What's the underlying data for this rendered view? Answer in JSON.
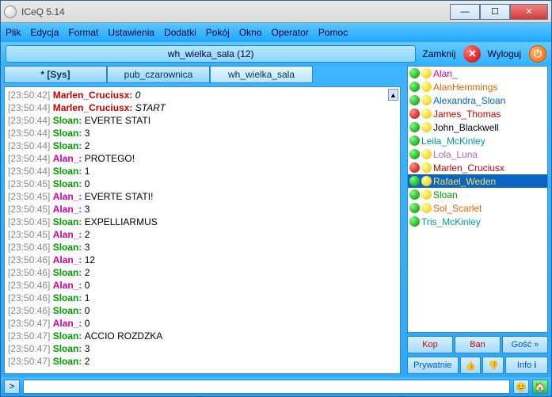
{
  "window": {
    "title": "ICeQ 5.14"
  },
  "menu": [
    "Plik",
    "Edycja",
    "Format",
    "Ustawienia",
    "Dodatki",
    "Pokój",
    "Okno",
    "Operator",
    "Pomoc"
  ],
  "room_header": {
    "title": "wh_wielka_sala (12)",
    "close_label": "Zamknij",
    "logout_label": "Wyloguj"
  },
  "tabs": [
    {
      "label": "* [Sys]",
      "active": false
    },
    {
      "label": "pub_czarownica",
      "active": false
    },
    {
      "label": "wh_wielka_sala",
      "active": true
    }
  ],
  "chat": [
    {
      "ts": "[23:50:42]",
      "nick": "Marlen_Cruciusx",
      "color": "#cc0000",
      "msg": "0",
      "italic": true
    },
    {
      "ts": "[23:50:44]",
      "nick": "Marlen_Cruciusx",
      "color": "#cc0000",
      "msg": "START",
      "italic": true
    },
    {
      "ts": "[23:50:44]",
      "nick": "Sloan",
      "color": "#009900",
      "msg": "EVERTE STATI"
    },
    {
      "ts": "[23:50:44]",
      "nick": "Sloan",
      "color": "#009900",
      "msg": "3"
    },
    {
      "ts": "[23:50:44]",
      "nick": "Sloan",
      "color": "#009900",
      "msg": "2"
    },
    {
      "ts": "[23:50:44]",
      "nick": "Alan_",
      "color": "#cc00aa",
      "msg": "PROTEGO!"
    },
    {
      "ts": "[23:50:44]",
      "nick": "Sloan",
      "color": "#009900",
      "msg": "1"
    },
    {
      "ts": "[23:50:45]",
      "nick": "Sloan",
      "color": "#009900",
      "msg": "0"
    },
    {
      "ts": "[23:50:45]",
      "nick": "Alan_",
      "color": "#cc00aa",
      "msg": "EVERTE STATI!"
    },
    {
      "ts": "[23:50:45]",
      "nick": "Alan_",
      "color": "#cc00aa",
      "msg": "3"
    },
    {
      "ts": "[23:50:45]",
      "nick": "Sloan",
      "color": "#009900",
      "msg": "EXPELLIARMUS"
    },
    {
      "ts": "[23:50:45]",
      "nick": "Alan_",
      "color": "#cc00aa",
      "msg": "2"
    },
    {
      "ts": "[23:50:46]",
      "nick": "Sloan",
      "color": "#009900",
      "msg": "3"
    },
    {
      "ts": "[23:50:46]",
      "nick": "Alan_",
      "color": "#cc00aa",
      "msg": "12"
    },
    {
      "ts": "[23:50:46]",
      "nick": "Sloan",
      "color": "#009900",
      "msg": "2"
    },
    {
      "ts": "[23:50:46]",
      "nick": "Alan_",
      "color": "#cc00aa",
      "msg": "0"
    },
    {
      "ts": "[23:50:46]",
      "nick": "Sloan",
      "color": "#009900",
      "msg": "1"
    },
    {
      "ts": "[23:50:46]",
      "nick": "Sloan",
      "color": "#009900",
      "msg": "0"
    },
    {
      "ts": "[23:50:47]",
      "nick": "Alan_",
      "color": "#cc00aa",
      "msg": "0"
    },
    {
      "ts": "[23:50:47]",
      "nick": "Sloan",
      "color": "#009900",
      "msg": "ACCIO ROZDZKA"
    },
    {
      "ts": "[23:50:47]",
      "nick": "Sloan",
      "color": "#009900",
      "msg": "3"
    },
    {
      "ts": "[23:50:47]",
      "nick": "Sloan",
      "color": "#009900",
      "msg": "2"
    }
  ],
  "users": [
    {
      "name": "Alan_",
      "color": "#cc00aa",
      "dots": [
        "green",
        "yellow"
      ]
    },
    {
      "name": "AlanHemmings",
      "color": "#dd6600",
      "dots": [
        "green",
        "yellow"
      ]
    },
    {
      "name": "Alexandra_Sloan",
      "color": "#0066cc",
      "dots": [
        "green",
        "yellow"
      ]
    },
    {
      "name": "James_Thomas",
      "color": "#cc0000",
      "dots": [
        "red",
        "yellow"
      ]
    },
    {
      "name": "John_Blackwell",
      "color": "#000000",
      "dots": [
        "green",
        "yellow"
      ]
    },
    {
      "name": "Leila_McKinley",
      "color": "#009999",
      "dots": [
        "green"
      ]
    },
    {
      "name": "Lola_Luna",
      "color": "#aa66cc",
      "dots": [
        "green",
        "yellow"
      ]
    },
    {
      "name": "Marlen_Cruciusx",
      "color": "#cc0000",
      "dots": [
        "red",
        "yellow"
      ]
    },
    {
      "name": "Rafael_Weden",
      "color": "#ffde59",
      "dots": [
        "green",
        "yellow"
      ],
      "selected": true
    },
    {
      "name": "Sloan",
      "color": "#009900",
      "dots": [
        "green",
        "yellow"
      ]
    },
    {
      "name": "Sol_Scarlet",
      "color": "#dd6600",
      "dots": [
        "green",
        "yellow"
      ]
    },
    {
      "name": "Tris_McKinley",
      "color": "#009999",
      "dots": [
        "green"
      ]
    }
  ],
  "actions": {
    "kop": "Kop",
    "ban": "Ban",
    "gosc": "Gość »",
    "prywatnie": "Prywatnie",
    "thumbs_up": "👍",
    "thumbs_down": "👎",
    "info": "Info"
  },
  "bottom": {
    "expand": ">",
    "face": "😊",
    "home": "🏠"
  }
}
